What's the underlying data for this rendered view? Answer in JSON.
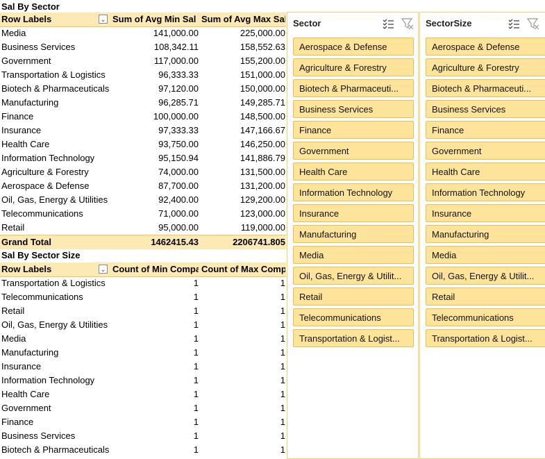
{
  "pivot1": {
    "title": "Sal By Sector",
    "headers": [
      "Row Labels",
      "Sum of Avg Min Sal",
      "Sum of Avg Max Sal"
    ],
    "rows": [
      [
        "Media",
        "141,000.00",
        "225,000.00"
      ],
      [
        "Business Services",
        "108,342.11",
        "158,552.63"
      ],
      [
        "Government",
        "117,000.00",
        "155,200.00"
      ],
      [
        "Transportation & Logistics",
        "96,333.33",
        "151,000.00"
      ],
      [
        "Biotech & Pharmaceuticals",
        "97,120.00",
        "150,000.00"
      ],
      [
        "Manufacturing",
        "96,285.71",
        "149,285.71"
      ],
      [
        "Finance",
        "100,000.00",
        "148,500.00"
      ],
      [
        "Insurance",
        "97,333.33",
        "147,166.67"
      ],
      [
        "Health Care",
        "93,750.00",
        "146,250.00"
      ],
      [
        "Information Technology",
        "95,150.94",
        "141,886.79"
      ],
      [
        "Agriculture & Forestry",
        "74,000.00",
        "131,500.00"
      ],
      [
        "Aerospace & Defense",
        "87,700.00",
        "131,200.00"
      ],
      [
        "Oil, Gas, Energy & Utilities",
        "92,400.00",
        "129,200.00"
      ],
      [
        "Telecommunications",
        "71,000.00",
        "123,000.00"
      ],
      [
        "Retail",
        "95,000.00",
        "119,000.00"
      ]
    ],
    "total": [
      "Grand Total",
      "1462415.43",
      "2206741.805"
    ]
  },
  "pivot2": {
    "title": "Sal By Sector Size",
    "headers": [
      "Row Labels",
      "Count of Min Compa",
      "Count of Max Comp"
    ],
    "rows": [
      [
        "Transportation & Logistics",
        "1",
        "1"
      ],
      [
        "Telecommunications",
        "1",
        "1"
      ],
      [
        "Retail",
        "1",
        "1"
      ],
      [
        "Oil, Gas, Energy & Utilities",
        "1",
        "1"
      ],
      [
        "Media",
        "1",
        "1"
      ],
      [
        "Manufacturing",
        "1",
        "1"
      ],
      [
        "Insurance",
        "1",
        "1"
      ],
      [
        "Information Technology",
        "1",
        "1"
      ],
      [
        "Health Care",
        "1",
        "1"
      ],
      [
        "Government",
        "1",
        "1"
      ],
      [
        "Finance",
        "1",
        "1"
      ],
      [
        "Business Services",
        "1",
        "1"
      ],
      [
        "Biotech & Pharmaceuticals",
        "1",
        "1"
      ]
    ]
  },
  "slicers": [
    {
      "title": "Sector",
      "items": [
        "Aerospace & Defense",
        "Agriculture & Forestry",
        "Biotech & Pharmaceuti...",
        "Business Services",
        "Finance",
        "Government",
        "Health Care",
        "Information Technology",
        "Insurance",
        "Manufacturing",
        "Media",
        "Oil, Gas, Energy & Utilit...",
        "Retail",
        "Telecommunications",
        "Transportation & Logist..."
      ]
    },
    {
      "title": "SectorSize",
      "items": [
        "Aerospace & Defense",
        "Agriculture & Forestry",
        "Biotech & Pharmaceuti...",
        "Business Services",
        "Finance",
        "Government",
        "Health Care",
        "Information Technology",
        "Insurance",
        "Manufacturing",
        "Media",
        "Oil, Gas, Energy & Utilit...",
        "Retail",
        "Telecommunications",
        "Transportation & Logist..."
      ]
    }
  ],
  "colors": {
    "header_fill": "#fce9b3",
    "slicer_button": "#fde49a",
    "slicer_border": "#f0d66a"
  },
  "icons": {
    "filter_dropdown": "dropdown-filter-icon",
    "multi_select": "multi-select-icon",
    "clear_filter": "clear-filter-icon"
  }
}
